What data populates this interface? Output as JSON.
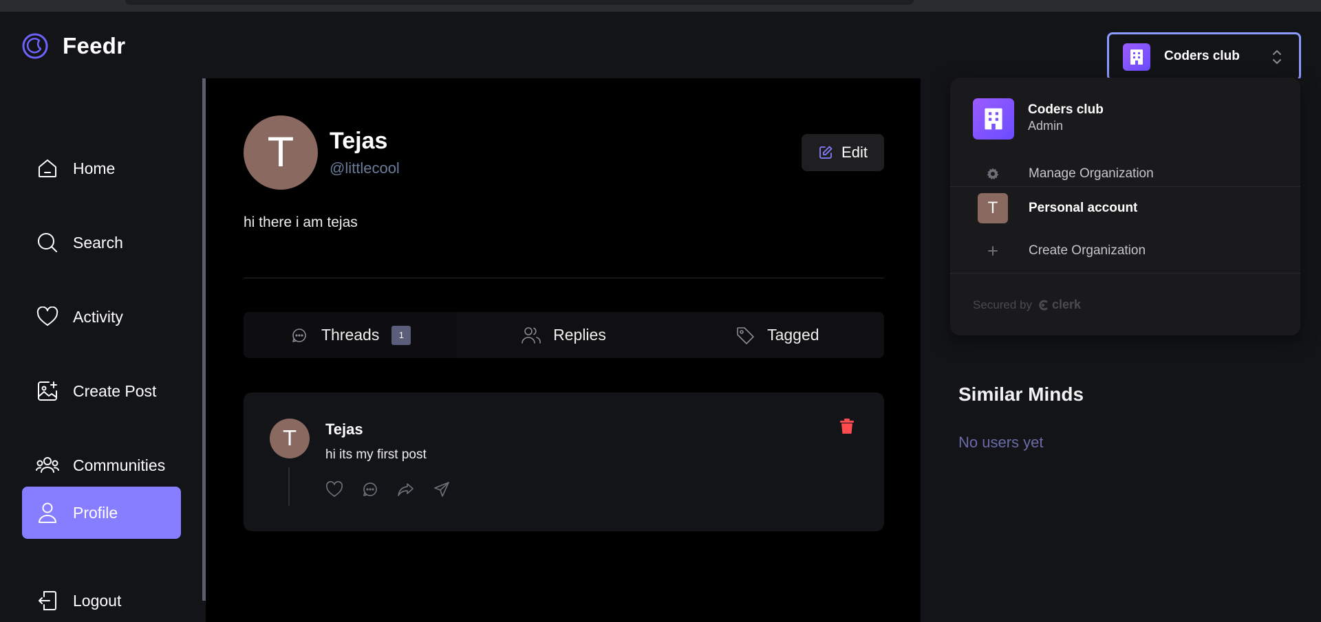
{
  "app": {
    "brand": "Feedr"
  },
  "org_switcher": {
    "name": "Coders club"
  },
  "sidebar": {
    "items": [
      {
        "label": "Home",
        "icon": "home-icon"
      },
      {
        "label": "Search",
        "icon": "search-icon"
      },
      {
        "label": "Activity",
        "icon": "heart-icon"
      },
      {
        "label": "Create Post",
        "icon": "image-plus-icon"
      },
      {
        "label": "Communities",
        "icon": "users-icon"
      },
      {
        "label": "Profile",
        "icon": "user-icon",
        "active": true
      },
      {
        "label": "Logout",
        "icon": "logout-icon"
      }
    ]
  },
  "profile": {
    "initial": "T",
    "name": "Tejas",
    "handle": "@littlecool",
    "edit_label": "Edit",
    "bio": "hi there i am tejas"
  },
  "tabs": [
    {
      "label": "Threads",
      "icon": "chat-bubble-icon",
      "badge": "1",
      "active": true
    },
    {
      "label": "Replies",
      "icon": "users-icon"
    },
    {
      "label": "Tagged",
      "icon": "tag-icon"
    }
  ],
  "post": {
    "author_initial": "T",
    "author": "Tejas",
    "text": "hi its my first post",
    "actions": [
      "heart-icon",
      "reply-icon",
      "repost-icon",
      "share-icon"
    ]
  },
  "org_dropdown": {
    "org_name": "Coders club",
    "org_role": "Admin",
    "manage_label": "Manage Organization",
    "personal_initial": "T",
    "personal_label": "Personal account",
    "create_label": "Create Organization",
    "secured_label": "Secured by",
    "secured_brand": "clerk"
  },
  "similar": {
    "title": "Similar Minds",
    "empty_text": "No users yet"
  },
  "colors": {
    "accent": "#877eff",
    "org_gradient_start": "#9b5cff",
    "org_gradient_end": "#6a4cff",
    "delete": "#ff4d4f",
    "focus_ring": "#8c9cff"
  }
}
